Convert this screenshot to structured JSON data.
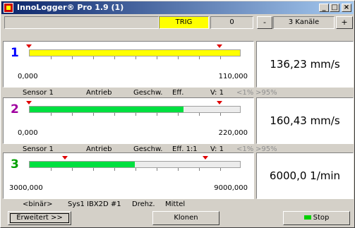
{
  "window": {
    "title": "InnoLogger® Pro 1.9 (1)",
    "min": "_",
    "max": "□",
    "close": "×"
  },
  "toolbar": {
    "trig": "TRIG",
    "trig_count": "0",
    "minus": "-",
    "channels": "3 Kanäle",
    "plus": "+"
  },
  "colors": {
    "ch1_fill": "#ffff00",
    "ch2_fill": "#00e040",
    "ch3_fill": "#00e040",
    "ch1_num": "#0000ff",
    "ch2_num": "#a000a0",
    "ch3_num": "#00a000",
    "trig_bg": "#ffff00"
  },
  "channels": [
    {
      "number": "1",
      "value": "136,23 mm/s",
      "min": "0,000",
      "max": "110,000",
      "fill_fraction": 1.0,
      "info": {
        "sensor": "Sensor 1",
        "type": "Antrieb",
        "measure": "Geschw.",
        "mode": "Eff.",
        "v": "V: 1",
        "lo": "<1%",
        "hi": ">95%"
      }
    },
    {
      "number": "2",
      "value": "160,43 mm/s",
      "min": "0,000",
      "max": "220,000",
      "fill_fraction": 0.73,
      "info": {
        "sensor": "Sensor 1",
        "type": "Antrieb",
        "measure": "Geschw.",
        "mode": "Eff. 1:1",
        "v": "V: 1",
        "lo": "<1%",
        "hi": ">95%"
      }
    },
    {
      "number": "3",
      "value": "6000,0 1/min",
      "min": "3000,000",
      "max": "9000,000",
      "fill_fraction": 0.5,
      "info": {
        "sensor": "<binär>",
        "type": "Sys1 IBX2D #1",
        "measure": "Drehz.",
        "mode": "Mittel"
      }
    }
  ],
  "buttons": {
    "advanced": "Erweitert >>",
    "clone": "Klonen",
    "stop": "Stop"
  }
}
